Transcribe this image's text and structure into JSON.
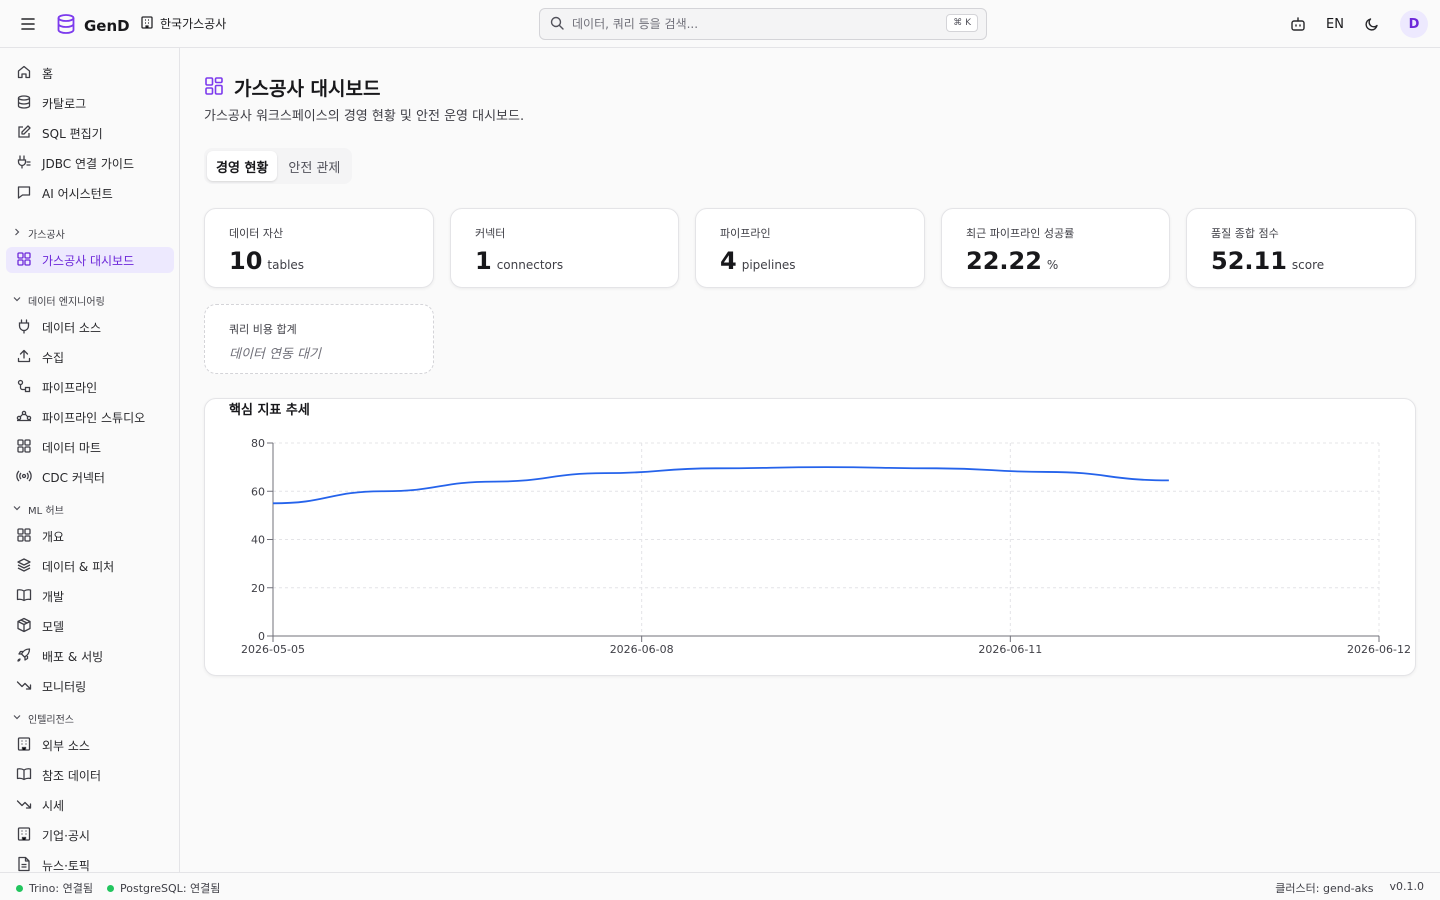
{
  "app": {
    "name": "GenD",
    "workspace": "한국가스공사"
  },
  "search": {
    "placeholder": "데이터, 쿼리 등을 검색...",
    "shortcut": "⌘ K"
  },
  "header": {
    "lang": "EN",
    "avatar": "D"
  },
  "sidebar": {
    "top_items": [
      {
        "label": "홈",
        "icon": "home-icon"
      },
      {
        "label": "카탈로그",
        "icon": "database-icon"
      },
      {
        "label": "SQL 편집기",
        "icon": "edit-icon"
      },
      {
        "label": "JDBC 연결 가이드",
        "icon": "plug-icon"
      },
      {
        "label": "AI 어시스턴트",
        "icon": "chat-icon"
      }
    ],
    "sections": {
      "gas": {
        "label": "가스공사",
        "items": [
          {
            "label": "가스공사 대시보드",
            "icon": "grid-icon",
            "active": true
          }
        ]
      },
      "eng": {
        "label": "데이터 엔지니어링",
        "items": [
          {
            "label": "데이터 소스",
            "icon": "plug-icon"
          },
          {
            "label": "수집",
            "icon": "upload-icon"
          },
          {
            "label": "파이프라인",
            "icon": "pipeline-icon"
          },
          {
            "label": "파이프라인 스튜디오",
            "icon": "workflow-icon"
          },
          {
            "label": "데이터 마트",
            "icon": "grid-icon"
          },
          {
            "label": "CDC 커넥터",
            "icon": "radio-icon"
          }
        ]
      },
      "ml": {
        "label": "ML 허브",
        "items": [
          {
            "label": "개요",
            "icon": "grid-icon"
          },
          {
            "label": "데이터 & 피처",
            "icon": "layers-icon"
          },
          {
            "label": "개발",
            "icon": "book-icon"
          },
          {
            "label": "모델",
            "icon": "box-icon"
          },
          {
            "label": "배포 & 서빙",
            "icon": "rocket-icon"
          },
          {
            "label": "모니터링",
            "icon": "trend-icon"
          }
        ]
      },
      "intel": {
        "label": "인텔리전스",
        "items": [
          {
            "label": "외부 소스",
            "icon": "building-icon"
          },
          {
            "label": "참조 데이터",
            "icon": "book-icon"
          },
          {
            "label": "시세",
            "icon": "trend-icon"
          },
          {
            "label": "기업·공시",
            "icon": "building-icon"
          },
          {
            "label": "뉴스·토픽",
            "icon": "document-icon"
          }
        ]
      }
    }
  },
  "page": {
    "title": "가스공사 대시보드",
    "description": "가스공사 워크스페이스의 경영 현황 및 안전 운영 대시보드.",
    "tabs": [
      {
        "label": "경영 현황",
        "active": true
      },
      {
        "label": "안전 관제",
        "active": false
      }
    ]
  },
  "cards": [
    {
      "label": "데이터 자산",
      "value": "10",
      "unit": "tables"
    },
    {
      "label": "커넥터",
      "value": "1",
      "unit": "connectors"
    },
    {
      "label": "파이프라인",
      "value": "4",
      "unit": "pipelines"
    },
    {
      "label": "최근 파이프라인 성공률",
      "value": "22.22",
      "unit": "%"
    },
    {
      "label": "품질 종합 점수",
      "value": "52.11",
      "unit": "score"
    }
  ],
  "pending_card": {
    "label": "쿼리 비용 합계",
    "status": "데이터 연동 대기"
  },
  "chart_data": {
    "type": "line",
    "title": "핵심 지표 추세",
    "x_tick_labels": [
      "2026-05-05",
      "2026-06-08",
      "2026-06-11",
      "2026-06-12"
    ],
    "y_ticks": [
      0,
      20,
      40,
      60,
      80
    ],
    "ylim": [
      0,
      80
    ],
    "grid": true,
    "series": [
      {
        "color": "#2563eb",
        "points": [
          {
            "x": 0.0,
            "y": 55
          },
          {
            "x": 0.1,
            "y": 60
          },
          {
            "x": 0.2,
            "y": 64
          },
          {
            "x": 0.3,
            "y": 67.5
          },
          {
            "x": 0.4,
            "y": 69.5
          },
          {
            "x": 0.5,
            "y": 70
          },
          {
            "x": 0.6,
            "y": 69.5
          },
          {
            "x": 0.7,
            "y": 68
          },
          {
            "x": 0.81,
            "y": 64.5
          }
        ]
      }
    ]
  },
  "footer": {
    "trino": "Trino: 연결됨",
    "postgres": "PostgreSQL: 연결됨",
    "cluster": "클러스터: gend-aks",
    "version": "v0.1.0"
  }
}
